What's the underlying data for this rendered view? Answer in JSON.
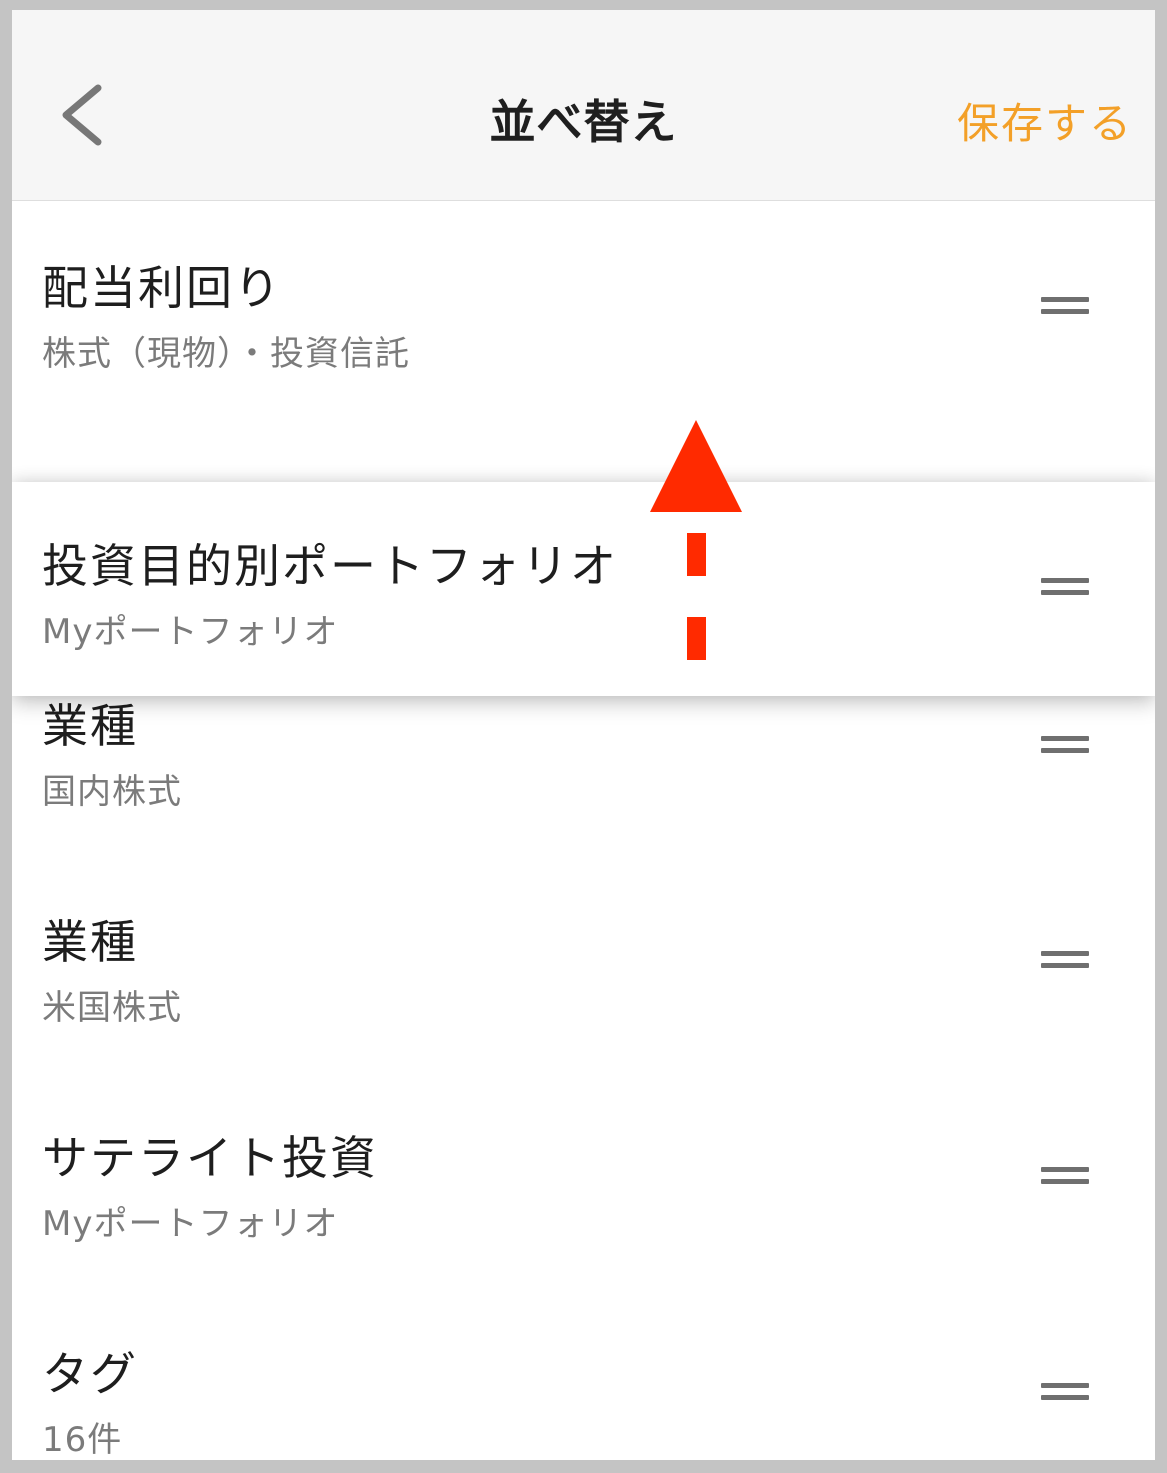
{
  "header": {
    "title": "並べ替え",
    "save_label": "保存する",
    "back_icon": "chevron-left-icon"
  },
  "accent_color": "#f3a028",
  "annotation_color": "#ff2a00",
  "items": [
    {
      "title": "配当利回り",
      "subtitle": "株式（現物）・投資信託"
    },
    {
      "title": "業種",
      "subtitle": "国内株式"
    },
    {
      "title": "業種",
      "subtitle": "米国株式"
    },
    {
      "title": "サテライト投資",
      "subtitle": "Myポートフォリオ"
    },
    {
      "title": "タグ",
      "subtitle": "16件"
    }
  ],
  "dragging_item": {
    "title": "投資目的別ポートフォリオ",
    "subtitle": "Myポートフォリオ"
  },
  "drag_handle_icon": "drag-handle-icon",
  "overlay_icon": "up-arrow-icon"
}
